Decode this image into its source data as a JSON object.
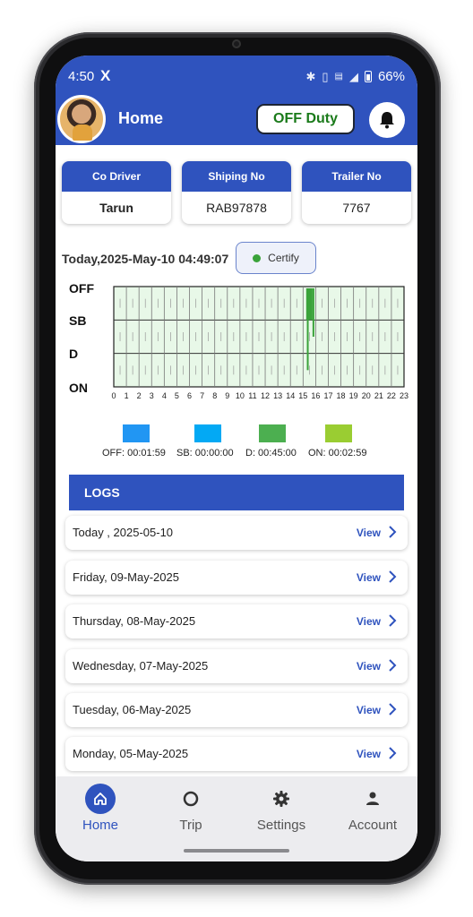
{
  "status_bar": {
    "time": "4:50",
    "x_icon": "X",
    "battery": "66%",
    "icons": [
      "bluetooth-icon",
      "vibrate-icon",
      "wifi-icon",
      "lte-icon",
      "signal-icon",
      "battery-icon"
    ]
  },
  "header": {
    "title": "Home",
    "duty_label": "OFF Duty",
    "colors": {
      "primary": "#2f53be",
      "duty_text": "#1a7a1a"
    }
  },
  "info_cards": [
    {
      "label": "Co Driver",
      "value": "Tarun"
    },
    {
      "label": "Shiping No",
      "value": "RAB97878"
    },
    {
      "label": "Trailer No",
      "value": "7767"
    }
  ],
  "today": "Today,2025-May-10 04:49:07",
  "certify_label": "Certify",
  "chart_data": {
    "type": "step-line",
    "rows": [
      "OFF",
      "SB",
      "D",
      "ON"
    ],
    "x_ticks": [
      "0",
      "1",
      "2",
      "3",
      "4",
      "5",
      "6",
      "7",
      "8",
      "9",
      "10",
      "11",
      "12",
      "13",
      "14",
      "15",
      "16",
      "17",
      "18",
      "19",
      "20",
      "21",
      "22",
      "23"
    ],
    "xlim": [
      0,
      23
    ],
    "segments": [
      {
        "status": "OFF",
        "start": 15.25,
        "end": 15.35
      },
      {
        "status": "D",
        "start": 15.3,
        "end": 15.35
      },
      {
        "status": "OFF",
        "start": 15.35,
        "end": 15.75
      },
      {
        "status": "SB",
        "start": 15.75,
        "end": 15.8
      }
    ],
    "legend": [
      {
        "label": "OFF: 00:01:59",
        "color": "#2196f3"
      },
      {
        "label": "SB: 00:00:00",
        "color": "#03a9f4"
      },
      {
        "label": "D: 00:45:00",
        "color": "#4caf50"
      },
      {
        "label": "ON: 00:02:59",
        "color": "#9acd32"
      }
    ],
    "grid": true,
    "background": "#e8f8e8",
    "line_color": "#3aa33a"
  },
  "logs": {
    "title": "LOGS",
    "view_label": "View",
    "items": [
      {
        "date": "Today , 2025-05-10"
      },
      {
        "date": "Friday,  09-May-2025"
      },
      {
        "date": "Thursday,  08-May-2025"
      },
      {
        "date": "Wednesday,  07-May-2025"
      },
      {
        "date": "Tuesday,  06-May-2025"
      },
      {
        "date": "Monday,  05-May-2025"
      }
    ]
  },
  "nav": [
    {
      "label": "Home",
      "icon": "home-icon",
      "active": true
    },
    {
      "label": "Trip",
      "icon": "circle-icon",
      "active": false
    },
    {
      "label": "Settings",
      "icon": "gear-icon",
      "active": false
    },
    {
      "label": "Account",
      "icon": "person-icon",
      "active": false
    }
  ]
}
